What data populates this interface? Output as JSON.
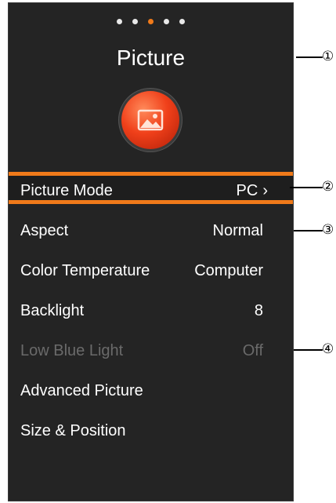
{
  "osd": {
    "page_dots": [
      {
        "active": false
      },
      {
        "active": false
      },
      {
        "active": true
      },
      {
        "active": false
      },
      {
        "active": false
      }
    ],
    "title": "Picture",
    "icon": "picture-icon",
    "colors": {
      "background": "#242424",
      "accent": "#f07a1a",
      "text": "#ffffff",
      "disabled_text": "#6a6a6a"
    },
    "menu": [
      {
        "label": "Picture Mode",
        "value": "PC",
        "chevron": "›",
        "selected": true,
        "disabled": false
      },
      {
        "label": "Aspect",
        "value": "Normal",
        "selected": false,
        "disabled": false
      },
      {
        "label": "Color Temperature",
        "value": "Computer",
        "selected": false,
        "disabled": false
      },
      {
        "label": "Backlight",
        "value": "8",
        "selected": false,
        "disabled": false
      },
      {
        "label": "Low Blue Light",
        "value": "Off",
        "selected": false,
        "disabled": true
      },
      {
        "label": "Advanced Picture",
        "value": "",
        "selected": false,
        "disabled": false
      },
      {
        "label": "Size & Position",
        "value": "",
        "selected": false,
        "disabled": false
      }
    ]
  },
  "callouts": [
    "①",
    "②",
    "③",
    "④"
  ]
}
